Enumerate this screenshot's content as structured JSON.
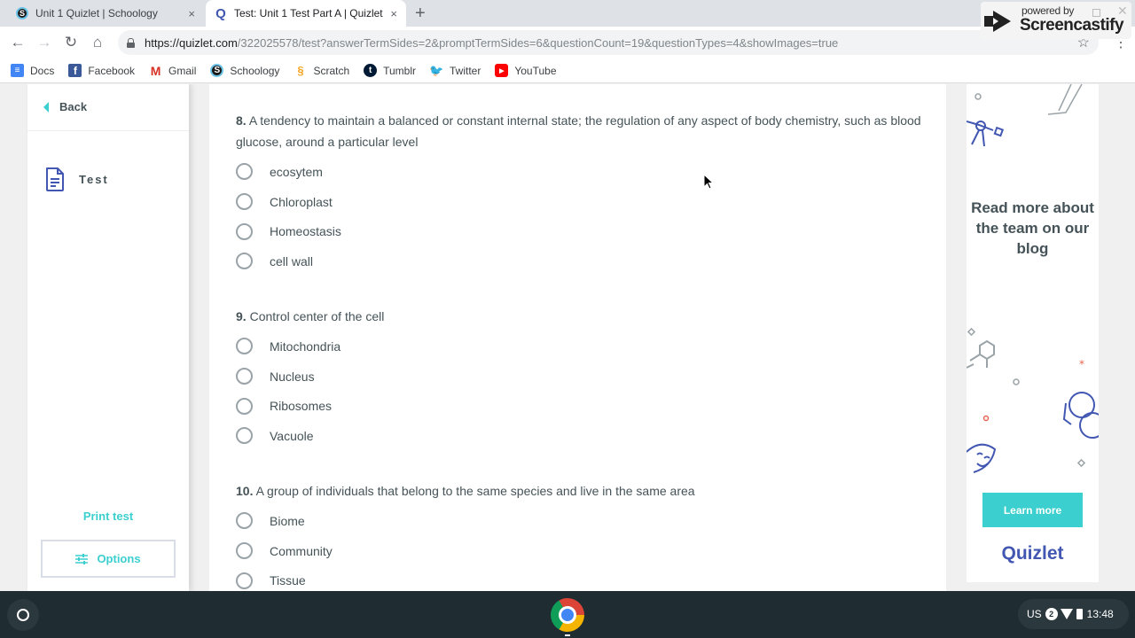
{
  "browser": {
    "tabs": [
      {
        "title": "Unit 1 Quizlet | Schoology",
        "favicon": "schoology-icon",
        "active": false
      },
      {
        "title": "Test: Unit 1 Test Part A | Quizlet",
        "favicon": "quizlet-icon",
        "active": true
      }
    ],
    "new_tab": "+",
    "close_glyph": "×",
    "url_domain": "https://quizlet.com",
    "url_path": "/322025578/test?answerTermSides=2&promptTermSides=6&questionCount=19&questionTypes=4&showImages=true",
    "bookmarks": [
      {
        "label": "Docs",
        "icon": "docs-icon",
        "glyph": "≡"
      },
      {
        "label": "Facebook",
        "icon": "facebook-icon",
        "glyph": "f"
      },
      {
        "label": "Gmail",
        "icon": "gmail-icon",
        "glyph": "M"
      },
      {
        "label": "Schoology",
        "icon": "schoology-icon",
        "glyph": "S"
      },
      {
        "label": "Scratch",
        "icon": "scratch-icon",
        "glyph": "§"
      },
      {
        "label": "Tumblr",
        "icon": "tumblr-icon",
        "glyph": "t"
      },
      {
        "label": "Twitter",
        "icon": "twitter-icon",
        "glyph": "🐦"
      },
      {
        "label": "YouTube",
        "icon": "youtube-icon",
        "glyph": "▶"
      }
    ]
  },
  "screencastify": {
    "powered_by": "powered by",
    "brand": "Screencastify"
  },
  "sidebar": {
    "back_label": "Back",
    "mode_label": "Test",
    "print_label": "Print test",
    "options_label": "Options"
  },
  "questions": [
    {
      "number": "8.",
      "prompt": "A tendency to maintain a balanced or constant internal state; the regulation of any aspect of body chemistry, such as blood glucose, around a particular level",
      "options": [
        "ecosytem",
        "Chloroplast",
        "Homeostasis",
        "cell wall"
      ]
    },
    {
      "number": "9.",
      "prompt": "Control center of the cell",
      "options": [
        "Mitochondria",
        "Nucleus",
        "Ribosomes",
        "Vacuole"
      ]
    },
    {
      "number": "10.",
      "prompt": "A group of individuals that belong to the same species and live in the same area",
      "options": [
        "Biome",
        "Community",
        "Tissue"
      ]
    }
  ],
  "ad": {
    "headline": "Read more about the team on our blog",
    "button_label": "Learn more",
    "logo": "Quizlet"
  },
  "shelf": {
    "keyboard": "US",
    "notifications": "2",
    "time": "13:48"
  },
  "colors": {
    "accent": "#3ccfcf",
    "brand": "#4257b2",
    "text": "#455358"
  }
}
